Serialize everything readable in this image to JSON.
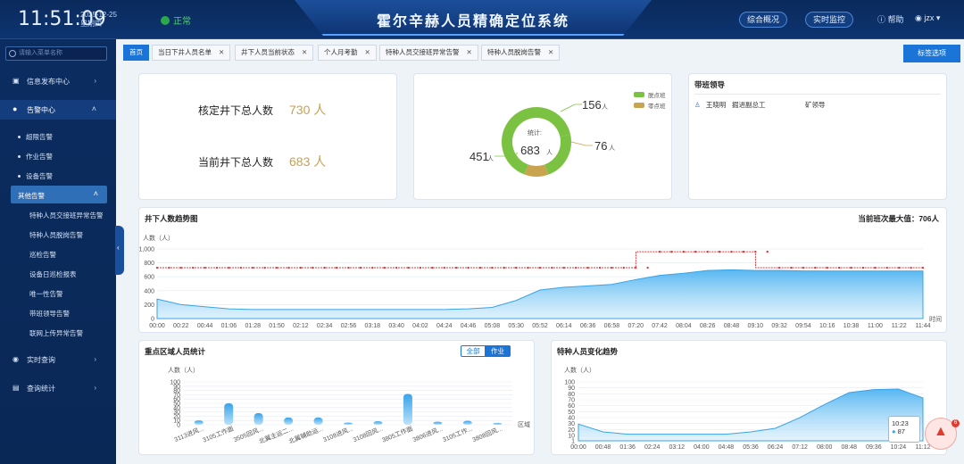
{
  "header": {
    "time": "11:51:09",
    "date": "2025-12-25",
    "weekday": "星期四",
    "status": "正常",
    "title": "霍尔辛赫人员精确定位系统",
    "btn1": "综合概况",
    "btn2": "实时监控",
    "help": "帮助",
    "user": "jzx"
  },
  "sidebar": {
    "search_placeholder": "请输入菜单名称",
    "items": [
      {
        "label": "信息发布中心"
      },
      {
        "label": "告警中心"
      },
      {
        "label": "实时查询"
      },
      {
        "label": "查询统计"
      }
    ],
    "alarm_subs": [
      "超限告警",
      "作业告警",
      "设备告警",
      "其他告警"
    ],
    "other_subs": [
      "特种人员交接班异常告警",
      "特种人员脱岗告警",
      "巡检告警",
      "设备日巡检报表",
      "唯一性告警",
      "带班领导告警",
      "联网上传异常告警"
    ]
  },
  "tabs": [
    {
      "label": "首页"
    },
    {
      "label": "当日下井人员名单"
    },
    {
      "label": "井下人员当前状态"
    },
    {
      "label": "个人月考勤"
    },
    {
      "label": "特种人员交接班异常告警"
    },
    {
      "label": "特种人员脱岗告警"
    }
  ],
  "tab_options": "标签选项",
  "stats": {
    "approved_label": "核定井下总人数",
    "approved_value": "730 人",
    "current_label": "当前井下总人数",
    "current_value": "683 人"
  },
  "donut": {
    "total_label": "统计:",
    "total": "683",
    "unit": "人",
    "legend": [
      "脱点班",
      "零点班"
    ],
    "slices": [
      {
        "value": 451,
        "label": "451",
        "color": "#7cc242"
      },
      {
        "value": 156,
        "label": "156",
        "color": "#7cc242"
      },
      {
        "value": 76,
        "label": "76",
        "color": "#c8a450"
      }
    ],
    "colors": {
      "green": "#7cc242",
      "gold": "#c8a450"
    }
  },
  "leader": {
    "title": "带班领导",
    "name": "王晓明",
    "role": "掘进副总工",
    "dept": "矿领导"
  },
  "trend": {
    "title": "井下人数趋势图",
    "max_text": "当前班次最大值：706人",
    "ylabel": "人数（人）",
    "xlabel": "时间"
  },
  "chart_data": [
    {
      "type": "area",
      "title": "井下人数趋势图",
      "ylabel": "人数（人）",
      "xlabel": "时间",
      "ylim": [
        0,
        1000
      ],
      "yticks": [
        0,
        200,
        400,
        600,
        800,
        1000
      ],
      "ytick_labels": [
        "0",
        "200",
        "400",
        "600",
        "800",
        "1,000"
      ],
      "x": [
        "00:00",
        "00:22",
        "00:44",
        "01:06",
        "01:28",
        "01:50",
        "02:12",
        "02:34",
        "02:56",
        "03:18",
        "03:40",
        "04:02",
        "04:24",
        "04:46",
        "05:08",
        "05:30",
        "05:52",
        "06:14",
        "06:36",
        "06:58",
        "07:20",
        "07:42",
        "08:04",
        "08:26",
        "08:48",
        "09:10",
        "09:32",
        "09:54",
        "10:16",
        "10:38",
        "11:00",
        "11:22",
        "11:44"
      ],
      "series": [
        {
          "values": [
            280,
            200,
            170,
            140,
            130,
            130,
            130,
            130,
            130,
            130,
            130,
            130,
            130,
            140,
            160,
            260,
            410,
            450,
            470,
            490,
            560,
            620,
            650,
            690,
            700,
            690,
            690,
            685,
            683,
            683,
            683,
            683,
            683
          ]
        },
        {
          "values": [
            730,
            730,
            730,
            730,
            730,
            730,
            730,
            730,
            730,
            730,
            730,
            730,
            730,
            730,
            730,
            730,
            730,
            730,
            730,
            730,
            730,
            960,
            960,
            960,
            960,
            960,
            730,
            730,
            730,
            730,
            730,
            730,
            730
          ]
        }
      ]
    },
    {
      "type": "bar",
      "title": "重点区域人员统计",
      "ylabel": "人数（人）",
      "xlabel": "区域",
      "ylim": [
        0,
        100
      ],
      "yticks": [
        0,
        10,
        20,
        30,
        40,
        50,
        60,
        70,
        80,
        90,
        100
      ],
      "categories": [
        "3113进风...",
        "3105工作面",
        "3505回风...",
        "北翼主运二...",
        "北翼辅助运...",
        "3108进风...",
        "3108回风...",
        "3805工作面",
        "3806进风...",
        "3105工作...",
        "3808回风..."
      ],
      "values": [
        10,
        50,
        27,
        17,
        17,
        5,
        8,
        72,
        7,
        9,
        4
      ]
    },
    {
      "type": "area",
      "title": "特种人员变化趋势",
      "ylabel": "人数（人）",
      "ylim": [
        1,
        100
      ],
      "ytick_labels": [
        "1",
        "10",
        "20",
        "30",
        "40",
        "50",
        "60",
        "70",
        "80",
        "90",
        "100"
      ],
      "x": [
        "00:00",
        "00:48",
        "01:36",
        "02:24",
        "03:12",
        "04:00",
        "04:48",
        "05:36",
        "06:24",
        "07:12",
        "08:00",
        "08:48",
        "09:36",
        "10:24",
        "11:12"
      ],
      "values": [
        29,
        16,
        12,
        12,
        12,
        12,
        12,
        16,
        22,
        40,
        62,
        82,
        87,
        88,
        73
      ],
      "tooltip": {
        "time": "10:23",
        "value": "87"
      }
    }
  ],
  "zones": {
    "title": "重点区域人员统计",
    "toggle_all": "全部",
    "toggle_work": "作业",
    "ylabel": "人数（人）",
    "xlabel": "区域"
  },
  "special": {
    "title": "特种人员变化趋势",
    "ylabel": "人数（人）"
  },
  "colors": {
    "accent": "#1b74d8",
    "sidebar": "#0b2c60",
    "area": "#4db3f0",
    "red": "#d93b3b"
  }
}
